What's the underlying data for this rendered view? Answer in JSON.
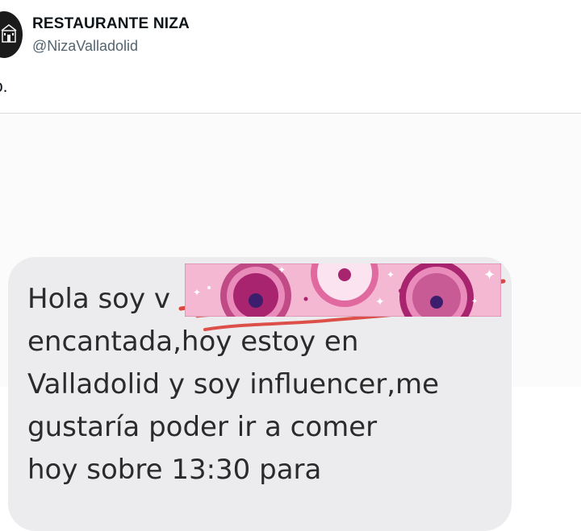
{
  "account": {
    "name": "RESTAURANTE NIZA",
    "handle": "@NizaValladolid",
    "avatar_icon": "restaurant-logo"
  },
  "tweet": {
    "text": "o."
  },
  "message": {
    "lines": [
      "Hola soy v",
      "encantada,hoy estoy en",
      "Valladolid y soy influencer,me",
      "gustaría poder ir a comer",
      "hoy sobre 13:30 para"
    ],
    "sticker_icon": "donuts-sticker",
    "redaction_icon": "red-scribble"
  },
  "colors": {
    "bubble": "#ececef",
    "message_text": "#2b2b2b",
    "handle": "#536471",
    "scribble": "#d9352b",
    "sticker_bg": "#f5b8d3",
    "donut": "#a8246e"
  }
}
